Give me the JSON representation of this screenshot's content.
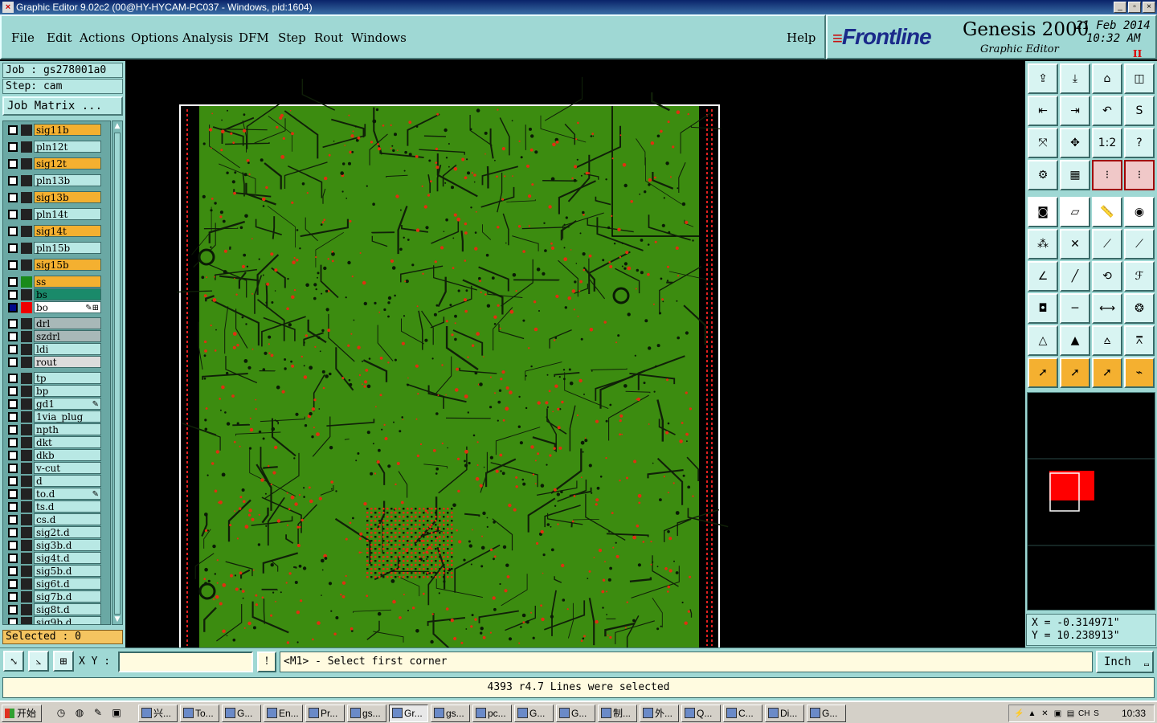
{
  "window": {
    "title": "Graphic Editor 9.02c2 (00@HY-HYCAM-PC037 - Windows, pid:1604)",
    "buttons": [
      "_",
      "▫",
      "×"
    ]
  },
  "menu": {
    "items": [
      "File",
      "Edit",
      "Actions",
      "Options",
      "Analysis",
      "DFM",
      "Step",
      "Rout",
      "Windows"
    ],
    "help": "Help"
  },
  "brand": {
    "logo": "Frontline",
    "product": "Genesis 2000",
    "subtitle": "Graphic Editor",
    "date": "21 Feb 2014",
    "time": "10:32 AM",
    "pause_glyph": "II"
  },
  "job": {
    "job_line": "Job : gs278001a0",
    "step_line": "Step: cam",
    "matrix_button": "Job Matrix ..."
  },
  "layers": [
    {
      "name": "sig11b",
      "color": "#f4b030",
      "checked": false,
      "swatch": "#222222"
    },
    {
      "name": "pln12t",
      "color": "#b8e8e4",
      "checked": false,
      "swatch": "#222222"
    },
    {
      "name": "sig12t",
      "color": "#f4b030",
      "checked": false,
      "swatch": "#222222"
    },
    {
      "name": "pln13b",
      "color": "#b8e8e4",
      "checked": false,
      "swatch": "#222222"
    },
    {
      "name": "sig13b",
      "color": "#f4b030",
      "checked": false,
      "swatch": "#222222"
    },
    {
      "name": "pln14t",
      "color": "#b8e8e4",
      "checked": false,
      "swatch": "#222222"
    },
    {
      "name": "sig14t",
      "color": "#f4b030",
      "checked": false,
      "swatch": "#222222"
    },
    {
      "name": "pln15b",
      "color": "#b8e8e4",
      "checked": false,
      "swatch": "#222222"
    },
    {
      "name": "sig15b",
      "color": "#f4b030",
      "checked": false,
      "swatch": "#222222"
    },
    {
      "name": "ss",
      "color": "#f4b030",
      "checked": false,
      "swatch": "#1a8a1a"
    },
    {
      "name": "bs",
      "color": "#1a8a6a",
      "checked": false,
      "swatch": "#222222"
    },
    {
      "name": "bo",
      "color": "#ffffff",
      "checked": true,
      "swatch": "#ee0000",
      "flag": "✎⊞"
    },
    {
      "name": "drl",
      "color": "#a8b8b8",
      "checked": false,
      "swatch": "#222222"
    },
    {
      "name": "szdrl",
      "color": "#a8b8b8",
      "checked": false,
      "swatch": "#222222"
    },
    {
      "name": "ldi",
      "color": "#b8e8e4",
      "checked": false,
      "swatch": "#222222"
    },
    {
      "name": "rout",
      "color": "#dcdcdc",
      "checked": false,
      "swatch": "#222222"
    },
    {
      "name": "tp",
      "color": "#b8e8e4",
      "checked": false,
      "swatch": "#222222"
    },
    {
      "name": "bp",
      "color": "#b8e8e4",
      "checked": false,
      "swatch": "#222222"
    },
    {
      "name": "gd1",
      "color": "#b8e8e4",
      "checked": false,
      "swatch": "#222222",
      "flag": "✎"
    },
    {
      "name": "1via_plug",
      "color": "#b8e8e4",
      "checked": false,
      "swatch": "#222222"
    },
    {
      "name": "npth",
      "color": "#b8e8e4",
      "checked": false,
      "swatch": "#222222"
    },
    {
      "name": "dkt",
      "color": "#b8e8e4",
      "checked": false,
      "swatch": "#222222"
    },
    {
      "name": "dkb",
      "color": "#b8e8e4",
      "checked": false,
      "swatch": "#222222"
    },
    {
      "name": "v-cut",
      "color": "#b8e8e4",
      "checked": false,
      "swatch": "#222222"
    },
    {
      "name": "d",
      "color": "#b8e8e4",
      "checked": false,
      "swatch": "#222222"
    },
    {
      "name": "to.d",
      "color": "#b8e8e4",
      "checked": false,
      "swatch": "#222222",
      "flag": "✎"
    },
    {
      "name": "ts.d",
      "color": "#b8e8e4",
      "checked": false,
      "swatch": "#222222"
    },
    {
      "name": "cs.d",
      "color": "#b8e8e4",
      "checked": false,
      "swatch": "#222222"
    },
    {
      "name": "sig2t.d",
      "color": "#b8e8e4",
      "checked": false,
      "swatch": "#222222"
    },
    {
      "name": "sig3b.d",
      "color": "#b8e8e4",
      "checked": false,
      "swatch": "#222222"
    },
    {
      "name": "sig4t.d",
      "color": "#b8e8e4",
      "checked": false,
      "swatch": "#222222"
    },
    {
      "name": "sig5b.d",
      "color": "#b8e8e4",
      "checked": false,
      "swatch": "#222222"
    },
    {
      "name": "sig6t.d",
      "color": "#b8e8e4",
      "checked": false,
      "swatch": "#222222"
    },
    {
      "name": "sig7b.d",
      "color": "#b8e8e4",
      "checked": false,
      "swatch": "#222222"
    },
    {
      "name": "sig8t.d",
      "color": "#b8e8e4",
      "checked": false,
      "swatch": "#222222"
    },
    {
      "name": "sig9b.d",
      "color": "#b8e8e4",
      "checked": false,
      "swatch": "#222222"
    }
  ],
  "selected_text": "Selected : 0",
  "toolbar": {
    "buttons": [
      {
        "name": "open-job-icon",
        "glyph": "⇪",
        "style": "default"
      },
      {
        "name": "save-icon",
        "glyph": "⤓",
        "style": "default"
      },
      {
        "name": "home-icon",
        "glyph": "⌂",
        "style": "default"
      },
      {
        "name": "window-split-icon",
        "glyph": "◫",
        "style": "default"
      },
      {
        "name": "zoom-back-icon",
        "glyph": "⇤",
        "style": "default"
      },
      {
        "name": "zoom-forward-icon",
        "glyph": "⇥",
        "style": "default"
      },
      {
        "name": "undo-zoom-icon",
        "glyph": "↶",
        "style": "default"
      },
      {
        "name": "redraw-icon",
        "glyph": "S",
        "style": "default"
      },
      {
        "name": "zoom-fit-icon",
        "glyph": "⤧",
        "style": "default"
      },
      {
        "name": "pan-icon",
        "glyph": "✥",
        "style": "default"
      },
      {
        "name": "scale-one-to-two-icon",
        "glyph": "1:2",
        "style": "default"
      },
      {
        "name": "help-icon",
        "glyph": "?",
        "style": "default"
      },
      {
        "name": "settings-icon",
        "glyph": "⚙",
        "style": "default"
      },
      {
        "name": "grid-icon",
        "glyph": "▦",
        "style": "default"
      },
      {
        "name": "layer-snap-icon",
        "glyph": "⁝",
        "style": "pink"
      },
      {
        "name": "layer-snap-alt-icon",
        "glyph": "⁝",
        "style": "pink"
      },
      {
        "name": "features-icon",
        "glyph": "◙",
        "style": "white"
      },
      {
        "name": "clip-area-icon",
        "glyph": "▱",
        "style": "white"
      },
      {
        "name": "ruler-icon",
        "glyph": "📏",
        "style": "white"
      },
      {
        "name": "pad-icon",
        "glyph": "◉",
        "style": "white"
      },
      {
        "name": "connect-nodes-icon",
        "glyph": "⁂",
        "style": "default"
      },
      {
        "name": "cross-point-icon",
        "glyph": "✕",
        "style": "default"
      },
      {
        "name": "line-add-icon",
        "glyph": "⟋",
        "style": "default"
      },
      {
        "name": "line-end-icon",
        "glyph": "⟋",
        "style": "default"
      },
      {
        "name": "angle-line-icon",
        "glyph": "∠",
        "style": "default"
      },
      {
        "name": "slash-line-icon",
        "glyph": "╱",
        "style": "default"
      },
      {
        "name": "arc-icon",
        "glyph": "⟲",
        "style": "default"
      },
      {
        "name": "text-feature-icon",
        "glyph": "ℱ",
        "style": "default"
      },
      {
        "name": "add-pad-icon",
        "glyph": "◘",
        "style": "default"
      },
      {
        "name": "horizontal-line-icon",
        "glyph": "─",
        "style": "default"
      },
      {
        "name": "measure-span-icon",
        "glyph": "⟷",
        "style": "default"
      },
      {
        "name": "circles-icon",
        "glyph": "❂",
        "style": "default"
      },
      {
        "name": "triangle-a-icon",
        "glyph": "△",
        "style": "default"
      },
      {
        "name": "triangle-b-icon",
        "glyph": "▲",
        "style": "default"
      },
      {
        "name": "triangle-c-icon",
        "glyph": "⩟",
        "style": "default"
      },
      {
        "name": "triangle-d-icon",
        "glyph": "⩞",
        "style": "default"
      },
      {
        "name": "pointer-icon",
        "glyph": "➚",
        "style": "orange"
      },
      {
        "name": "select-icon",
        "glyph": "➚",
        "style": "orange"
      },
      {
        "name": "select-area-icon",
        "glyph": "➚",
        "style": "orange"
      },
      {
        "name": "route-select-icon",
        "glyph": "⌁",
        "style": "orange"
      }
    ]
  },
  "coords": {
    "x": "X = -0.314971\"",
    "y": "Y = 10.238913\""
  },
  "command": {
    "xy_label": "X Y :",
    "xy_value": "",
    "info_glyph": "!",
    "prompt": "<M1> - Select first corner",
    "units": "Inch",
    "units_dd": "▭"
  },
  "status_message": "4393 r4.7 Lines were selected",
  "taskbar": {
    "start": "开始",
    "tasks": [
      "兴...",
      "To...",
      "G...",
      "En...",
      "Pr...",
      "gs...",
      "Gr...",
      "gs...",
      "pc...",
      "G...",
      "G...",
      "制...",
      "外...",
      "Q...",
      "C...",
      "Di...",
      "G..."
    ],
    "active_index": 6,
    "clock": "10:33",
    "tray_icons": [
      "⚡",
      "▲",
      "✕",
      "▣",
      "▤",
      "CH",
      "S"
    ]
  }
}
